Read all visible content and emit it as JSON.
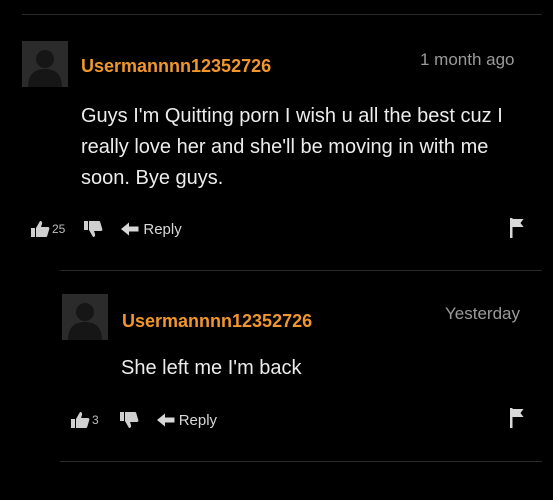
{
  "comments": [
    {
      "username": "Usermannnn12352726",
      "timestamp": "1 month ago",
      "text": "Guys I'm Quitting porn I wish u all the best cuz I really love her and she'll be moving in with me soon. Bye guys.",
      "upvotes": "25",
      "reply_label": "Reply"
    },
    {
      "username": "Usermannnn12352726",
      "timestamp": "Yesterday",
      "text": "She left me I'm back",
      "upvotes": "3",
      "reply_label": "Reply"
    }
  ],
  "colors": {
    "username": "#f0962c",
    "background": "#000000",
    "text": "#ececec",
    "timestamp": "#9a9a9a"
  },
  "icons": [
    "user-avatar-icon",
    "thumbs-up-icon",
    "thumbs-down-icon",
    "reply-arrow-icon",
    "flag-icon"
  ]
}
